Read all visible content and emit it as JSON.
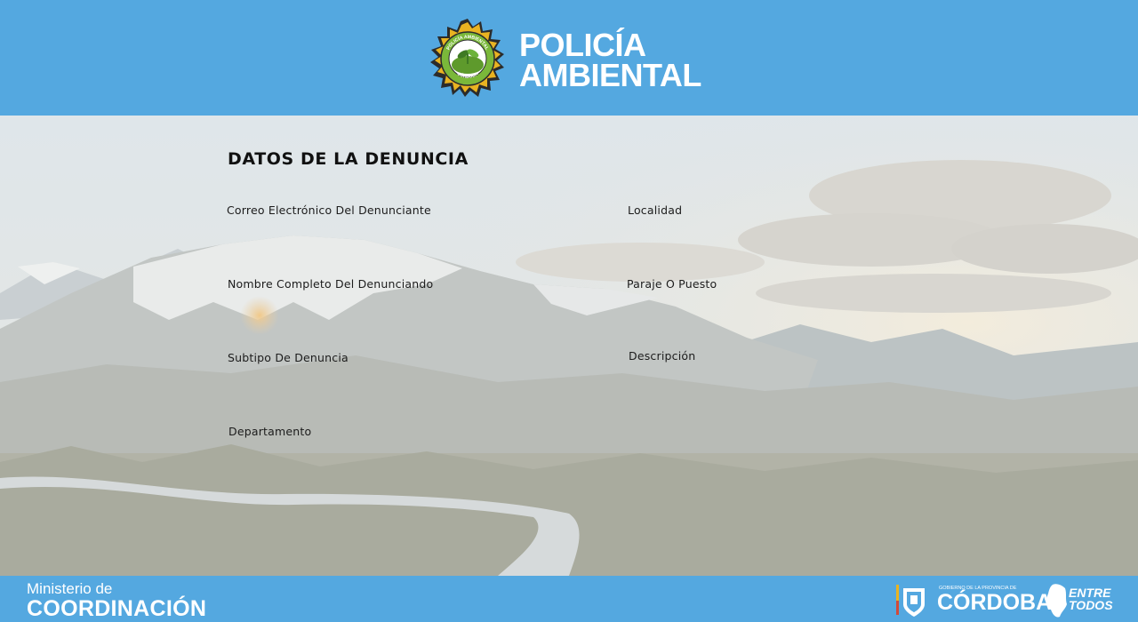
{
  "header": {
    "brand_line1": "POLICÍA",
    "brand_line2": "AMBIENTAL",
    "badge_top_text": "POLICÍA AMBIENTAL",
    "badge_bottom_text": "CÓRDOBA"
  },
  "form": {
    "section_title": "DATOS DE LA DENUNCIA",
    "left_fields": [
      "Correo Electrónico Del Denunciante",
      "Nombre Completo Del Denunciando",
      "Subtipo De Denuncia",
      "Departamento"
    ],
    "right_fields": [
      "Localidad",
      "Paraje O Puesto",
      "Descripción"
    ]
  },
  "footer": {
    "ministry_small": "Ministerio de",
    "ministry_big": "COORDINACIÓN",
    "gov_sub": "GOBIERNO DE LA PROVINCIA DE",
    "gov_name": "CÓRDOBA",
    "slogan_line1": "ENTRE",
    "slogan_line2": "TODOS"
  },
  "colors": {
    "brand_blue": "#54a8e0",
    "badge_gold": "#e9b321",
    "badge_green": "#7ab83a"
  }
}
